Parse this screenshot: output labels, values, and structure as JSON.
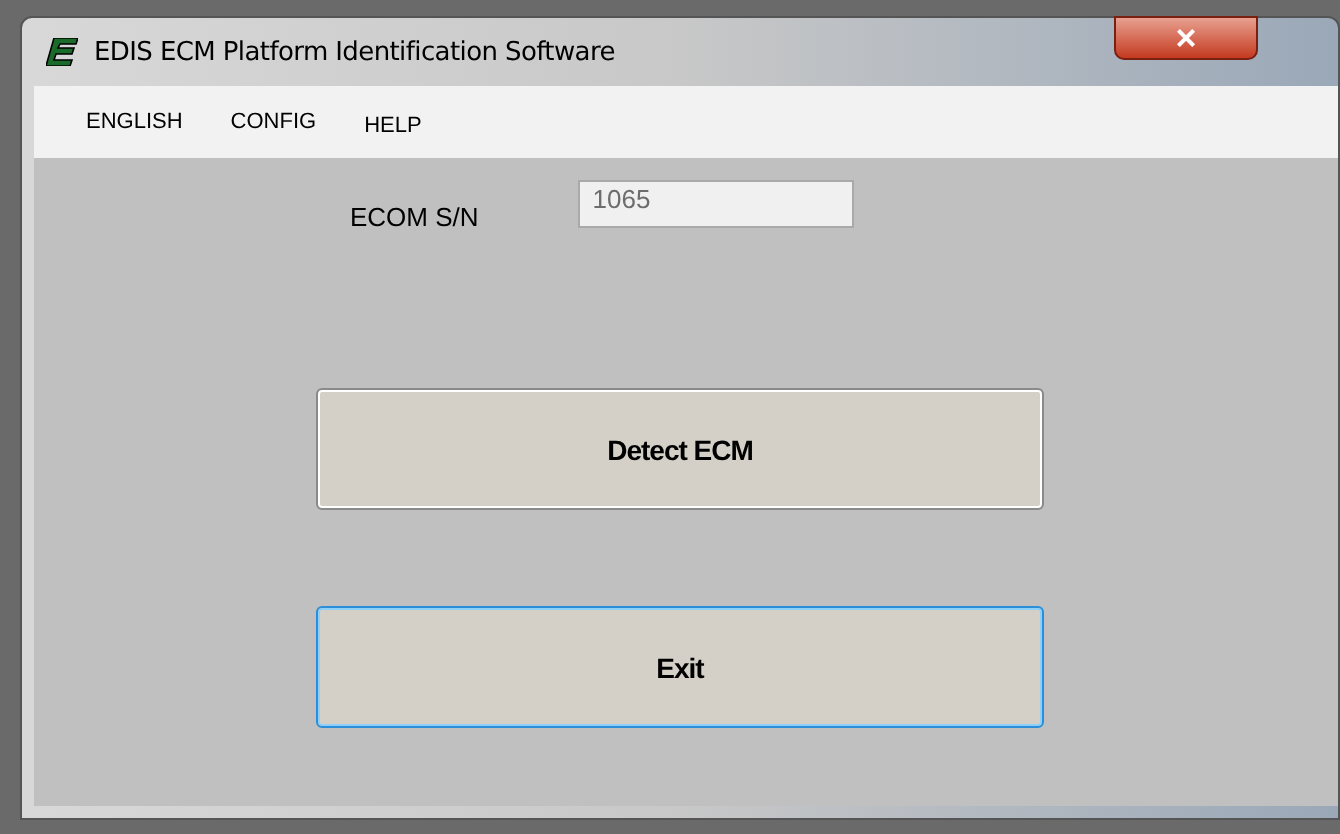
{
  "window": {
    "title": "EDIS ECM Platform Identification Software",
    "close": "×"
  },
  "menu": [
    {
      "label": "ENGLISH"
    },
    {
      "label": "CONFIG"
    },
    {
      "label": "HELP"
    }
  ],
  "serial": {
    "label": "ECOM S/N",
    "value": "1065",
    "disabled": true
  },
  "buttons": [
    {
      "label": "Detect ECM",
      "focused": false
    },
    {
      "label": "Exit",
      "focused": true
    }
  ]
}
